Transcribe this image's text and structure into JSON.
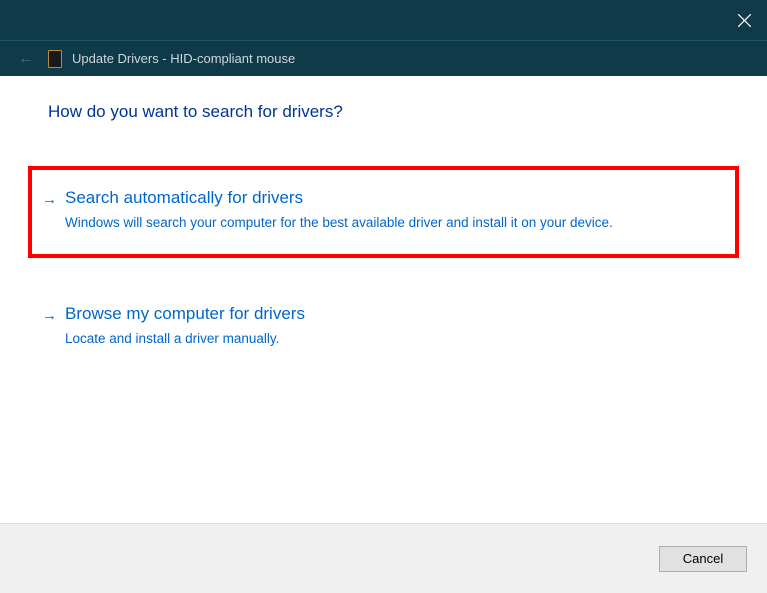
{
  "titlebar": {
    "close_label": "Close"
  },
  "header": {
    "title": "Update Drivers - HID-compliant mouse"
  },
  "main": {
    "heading": "How do you want to search for drivers?",
    "options": [
      {
        "title": "Search automatically for drivers",
        "description": "Windows will search your computer for the best available driver and install it on your device.",
        "highlighted": true
      },
      {
        "title": "Browse my computer for drivers",
        "description": "Locate and install a driver manually.",
        "highlighted": false
      }
    ]
  },
  "footer": {
    "cancel_label": "Cancel"
  }
}
